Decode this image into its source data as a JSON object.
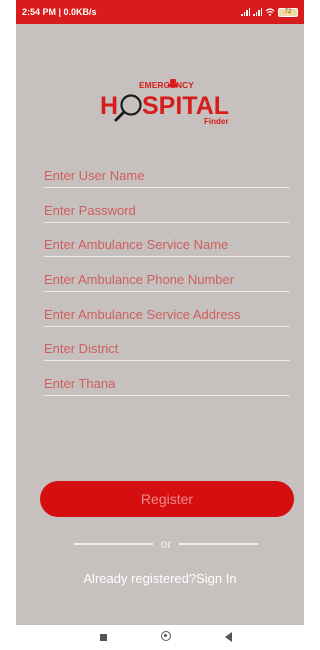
{
  "status_bar": {
    "time": "2:54 PM | 0.0KB/s",
    "signal_1": ".ill",
    "signal_2": ".ill",
    "battery": "72"
  },
  "logo": {
    "line1": "EMERGENCY",
    "line2_prefix": "H",
    "line2_suffix": "SPITAL",
    "line3": "Finder",
    "brand_red": "#d81c1c"
  },
  "form": {
    "fields": [
      {
        "placeholder": "Enter User Name",
        "value": ""
      },
      {
        "placeholder": "Enter Password",
        "value": ""
      },
      {
        "placeholder": "Enter Ambulance Service Name",
        "value": ""
      },
      {
        "placeholder": "Enter Ambulance Phone Number",
        "value": ""
      },
      {
        "placeholder": "Enter Ambulance Service Address",
        "value": ""
      },
      {
        "placeholder": "Enter District",
        "value": ""
      },
      {
        "placeholder": "Enter Thana",
        "value": ""
      }
    ],
    "register_label": "Register",
    "or_label": "or",
    "signin_label": "Already registered?Sign In"
  },
  "nav": {
    "icons": [
      "recent-apps-icon",
      "home-icon",
      "back-icon"
    ]
  },
  "colors": {
    "background": "#c6c1bf",
    "accent": "#d50f0f",
    "placeholder": "#cf5e5e"
  }
}
